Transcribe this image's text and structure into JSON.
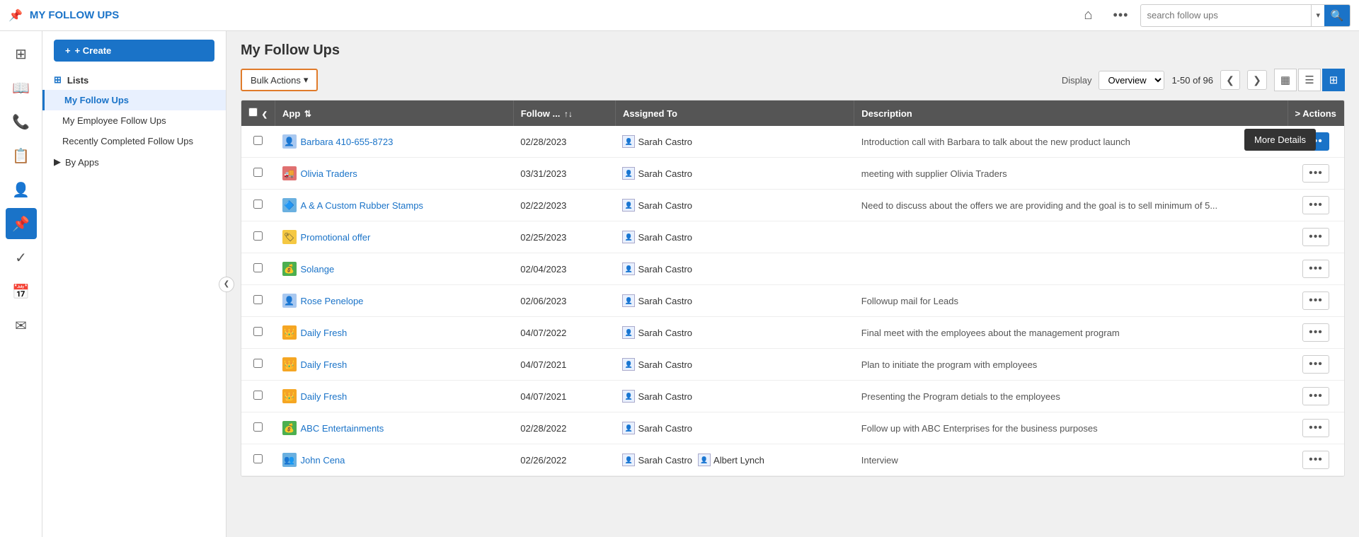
{
  "topbar": {
    "title": "MY FOLLOW UPS",
    "pin_icon": "📌",
    "home_icon": "⌂",
    "dots_icon": "•••",
    "search_placeholder": "search follow ups",
    "search_arrow": "▾",
    "search_btn_icon": "🔍"
  },
  "icon_rail": [
    {
      "name": "grid-icon",
      "icon": "⊞",
      "active": false
    },
    {
      "name": "book-icon",
      "icon": "📖",
      "active": false
    },
    {
      "name": "phone-icon",
      "icon": "📞",
      "active": false
    },
    {
      "name": "note-icon",
      "icon": "📋",
      "active": false
    },
    {
      "name": "person-icon",
      "icon": "👤",
      "active": false
    },
    {
      "name": "pin-nav-icon",
      "icon": "📌",
      "active": true
    },
    {
      "name": "check-icon",
      "icon": "✓",
      "active": false
    },
    {
      "name": "calendar-icon",
      "icon": "📅",
      "active": false
    },
    {
      "name": "mail-icon",
      "icon": "✉",
      "active": false
    }
  ],
  "sidebar": {
    "create_btn": "+ Create",
    "lists_label": "Lists",
    "lists_icon": "⊞",
    "items": [
      {
        "label": "My Follow Ups",
        "active": true
      },
      {
        "label": "My Employee Follow Ups",
        "active": false
      },
      {
        "label": "Recently Completed Follow Ups",
        "active": false
      }
    ],
    "by_apps_label": "By Apps",
    "collapse_icon": "❮"
  },
  "main": {
    "page_title": "My Follow Ups",
    "bulk_actions_label": "Bulk Actions",
    "bulk_actions_arrow": "▾",
    "display_label": "Display",
    "display_option": "Overview",
    "display_arrow": "▾",
    "pagination": "1-50 of 96",
    "prev_icon": "❮",
    "next_icon": "❯",
    "view_calendar_icon": "▦",
    "view_list_icon": "☰",
    "view_table_icon": "⊞",
    "table": {
      "columns": [
        {
          "key": "checkbox",
          "label": ""
        },
        {
          "key": "back",
          "label": "❮"
        },
        {
          "key": "app",
          "label": "App"
        },
        {
          "key": "follow_date",
          "label": "Follow ..."
        },
        {
          "key": "assigned_to",
          "label": "Assigned To"
        },
        {
          "key": "description",
          "label": "Description"
        },
        {
          "key": "actions",
          "label": "> Actions"
        }
      ],
      "rows": [
        {
          "id": 1,
          "app": "Barbara 410-655-8723",
          "app_icon_type": "person",
          "app_icon": "👤",
          "follow_date": "02/28/2023",
          "assigned_to": "Sarah Castro",
          "description": "Introduction call with Barbara to talk about the new product launch",
          "actions_highlighted": true
        },
        {
          "id": 2,
          "app": "Olivia Traders",
          "app_icon_type": "truck",
          "app_icon": "🚚",
          "follow_date": "03/31/2023",
          "assigned_to": "Sarah Castro",
          "description": "meeting with supplier Olivia Traders",
          "actions_highlighted": false
        },
        {
          "id": 3,
          "app": "A & A Custom Rubber Stamps",
          "app_icon_type": "stamp",
          "app_icon": "🔷",
          "follow_date": "02/22/2023",
          "assigned_to": "Sarah Castro",
          "description": "Need to discuss about the offers we are providing and the goal is to sell minimum of 5...",
          "actions_highlighted": false
        },
        {
          "id": 4,
          "app": "Promotional offer",
          "app_icon_type": "promo",
          "app_icon": "🏷",
          "follow_date": "02/25/2023",
          "assigned_to": "Sarah Castro",
          "description": "",
          "actions_highlighted": false
        },
        {
          "id": 5,
          "app": "Solange",
          "app_icon_type": "money",
          "app_icon": "💰",
          "follow_date": "02/04/2023",
          "assigned_to": "Sarah Castro",
          "description": "",
          "actions_highlighted": false
        },
        {
          "id": 6,
          "app": "Rose Penelope",
          "app_icon_type": "person",
          "app_icon": "👤",
          "follow_date": "02/06/2023",
          "assigned_to": "Sarah Castro",
          "description": "Followup mail for Leads",
          "actions_highlighted": false
        },
        {
          "id": 7,
          "app": "Daily Fresh",
          "app_icon_type": "crown",
          "app_icon": "👑",
          "follow_date": "04/07/2022",
          "assigned_to": "Sarah Castro",
          "description": "Final meet with the employees about the management program",
          "actions_highlighted": false
        },
        {
          "id": 8,
          "app": "Daily Fresh",
          "app_icon_type": "crown",
          "app_icon": "👑",
          "follow_date": "04/07/2021",
          "assigned_to": "Sarah Castro",
          "description": "Plan to initiate the program with employees",
          "actions_highlighted": false
        },
        {
          "id": 9,
          "app": "Daily Fresh",
          "app_icon_type": "crown",
          "app_icon": "👑",
          "follow_date": "04/07/2021",
          "assigned_to": "Sarah Castro",
          "description": "Presenting the Program detials to the employees",
          "actions_highlighted": false
        },
        {
          "id": 10,
          "app": "ABC Entertainments",
          "app_icon_type": "abc",
          "app_icon": "💰",
          "follow_date": "02/28/2022",
          "assigned_to": "Sarah Castro",
          "description": "Follow up with ABC Enterprises for the business purposes",
          "actions_highlighted": false
        },
        {
          "id": 11,
          "app": "John Cena",
          "app_icon_type": "people",
          "app_icon": "👥",
          "follow_date": "02/26/2022",
          "assigned_to": "Sarah Castro, Albert Lynch",
          "assigned_multi": true,
          "description": "Interview",
          "actions_highlighted": false
        }
      ],
      "more_details_label": "More Details"
    }
  }
}
